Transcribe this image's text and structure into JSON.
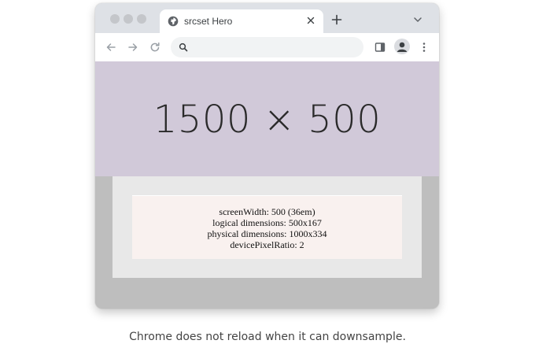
{
  "window": {
    "tab": {
      "title": "srcset Hero",
      "favicon": "globe-icon"
    },
    "toolbar": {
      "address_placeholder": ""
    }
  },
  "page": {
    "hero_text": "1500 × 500",
    "hero_bg": "#d1c9d9",
    "info_lines": [
      "screenWidth: 500 (36em)",
      "logical dimensions: 500x167",
      "physical dimensions: 1000x334",
      "devicePixelRatio: 2"
    ]
  },
  "caption": "Chrome does not reload when it can downsample."
}
